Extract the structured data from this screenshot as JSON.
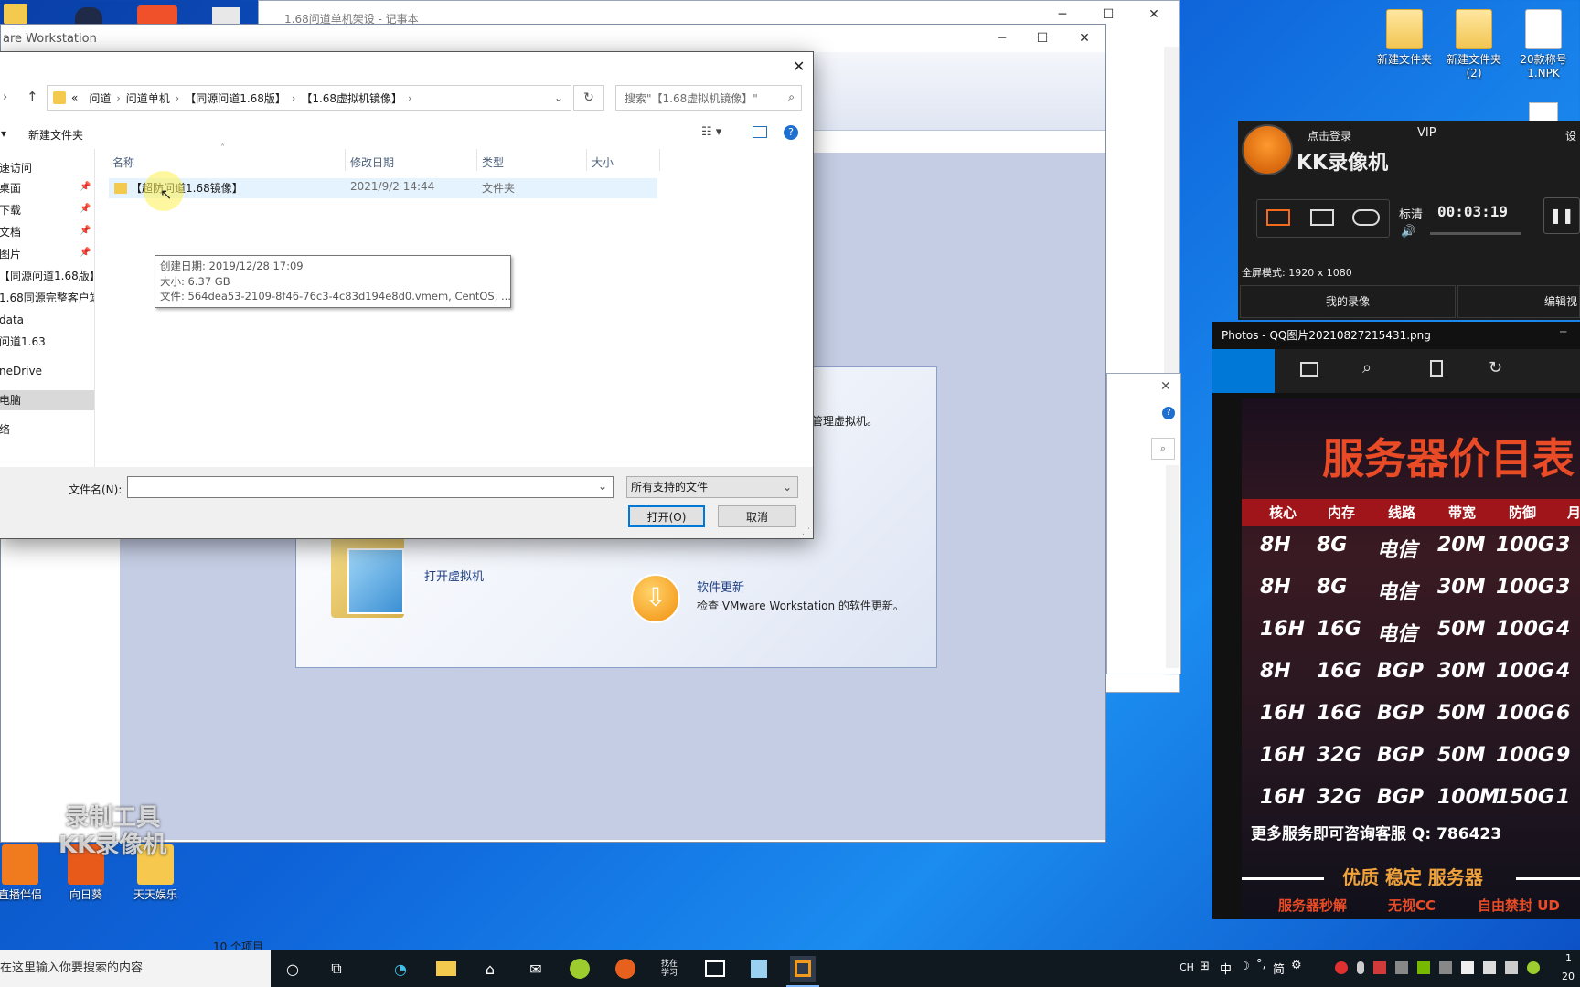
{
  "desktop": {
    "top_right_icons": [
      {
        "label": "新建文件夹"
      },
      {
        "label": "新建文件夹\n(2)"
      },
      {
        "label": "20款称号\n1.NPK"
      }
    ],
    "bottom_left_icons": [
      {
        "label": "直播伴侣"
      },
      {
        "label": "向日葵"
      },
      {
        "label": "天天娱乐"
      }
    ],
    "watermark": "录制工具\nKK录像机"
  },
  "notepad": {
    "title": "1.68问道单机架设 - 记事本",
    "status_count": "10 个项目"
  },
  "vmware": {
    "title": "are Workstation",
    "manage_text": "管理虚拟机。",
    "open_vm_label": "打开虚拟机",
    "update_title": "软件更新",
    "update_desc": "检查 VMware Workstation 的软件更新。"
  },
  "dialog": {
    "breadcrumb": [
      "«",
      "问道",
      "问道单机",
      "【同源问道1.68版】",
      "【1.68虚拟机镜像】"
    ],
    "search_placeholder": "搜索\"【1.68虚拟机镜像】\"",
    "toolbar": {
      "organize": "▾",
      "new_folder": "新建文件夹"
    },
    "nav_items": [
      "快速访问",
      "桌面",
      "下载",
      "文档",
      "图片",
      "【同源问道1.68版】",
      "1.68同源完整客户端",
      "data",
      "问道1.63",
      "OneDrive",
      "此电脑",
      "网络"
    ],
    "nav_display": [
      "速访问",
      "桌面",
      "下载",
      "文档",
      "图片",
      "【同源问道1.68版】",
      "1.68同源完整客户端",
      "data",
      "问道1.63",
      "neDrive",
      "电脑",
      "络"
    ],
    "columns": [
      "名称",
      "修改日期",
      "类型",
      "大小"
    ],
    "rows": [
      {
        "name": "【超防问道1.68镜像】",
        "date": "2021/9/2 14:44",
        "type": "文件夹",
        "size": ""
      }
    ],
    "tooltip": {
      "created": "创建日期: 2019/12/28 17:09",
      "size": "大小: 6.37 GB",
      "files": "文件: 564dea53-2109-8f46-76c3-4c83d194e8d0.vmem, CentOS, ..."
    },
    "filename_label": "文件名(N):",
    "filename_value": "",
    "filter_value": "所有支持的文件",
    "open_button": "打开(O)",
    "cancel_button": "取消"
  },
  "kk_recorder": {
    "login": "点击登录",
    "vip": "VIP",
    "settings": "设",
    "brand": "KK录像机",
    "quality": "标清",
    "timer": "00:03:19",
    "mode": "全屏模式: 1920 x 1080",
    "my_recordings": "我的录像",
    "edit_video": "编辑视"
  },
  "photos": {
    "title": "Photos - QQ图片20210827215431.png",
    "poster_title": "服务器价目表",
    "headers": [
      "核心",
      "内存",
      "线路",
      "带宽",
      "防御",
      "月"
    ],
    "rows": [
      [
        "8H",
        "8G",
        "电信",
        "20M",
        "100G",
        "3"
      ],
      [
        "8H",
        "8G",
        "电信",
        "30M",
        "100G",
        "3"
      ],
      [
        "16H",
        "16G",
        "电信",
        "50M",
        "100G",
        "4"
      ],
      [
        "8H",
        "16G",
        "BGP",
        "30M",
        "100G",
        "4"
      ],
      [
        "16H",
        "16G",
        "BGP",
        "50M",
        "100G",
        "6"
      ],
      [
        "16H",
        "32G",
        "BGP",
        "50M",
        "100G",
        "9"
      ],
      [
        "16H",
        "32G",
        "BGP",
        "100M",
        "150G",
        "1"
      ]
    ],
    "contact": "更多服务即可咨询客服 Q: 786423",
    "slogan": "优质 稳定 服务器",
    "footer": [
      "服务器秒解",
      "无视CC",
      "自由禁封 UD"
    ]
  },
  "taskbar": {
    "search_text": "在这里输入你要搜索的内容",
    "lang": "CH",
    "ime": "中",
    "ime2": "简",
    "tray_time": "1",
    "tray_date": "20",
    "find_learn": "找在\n学习"
  }
}
